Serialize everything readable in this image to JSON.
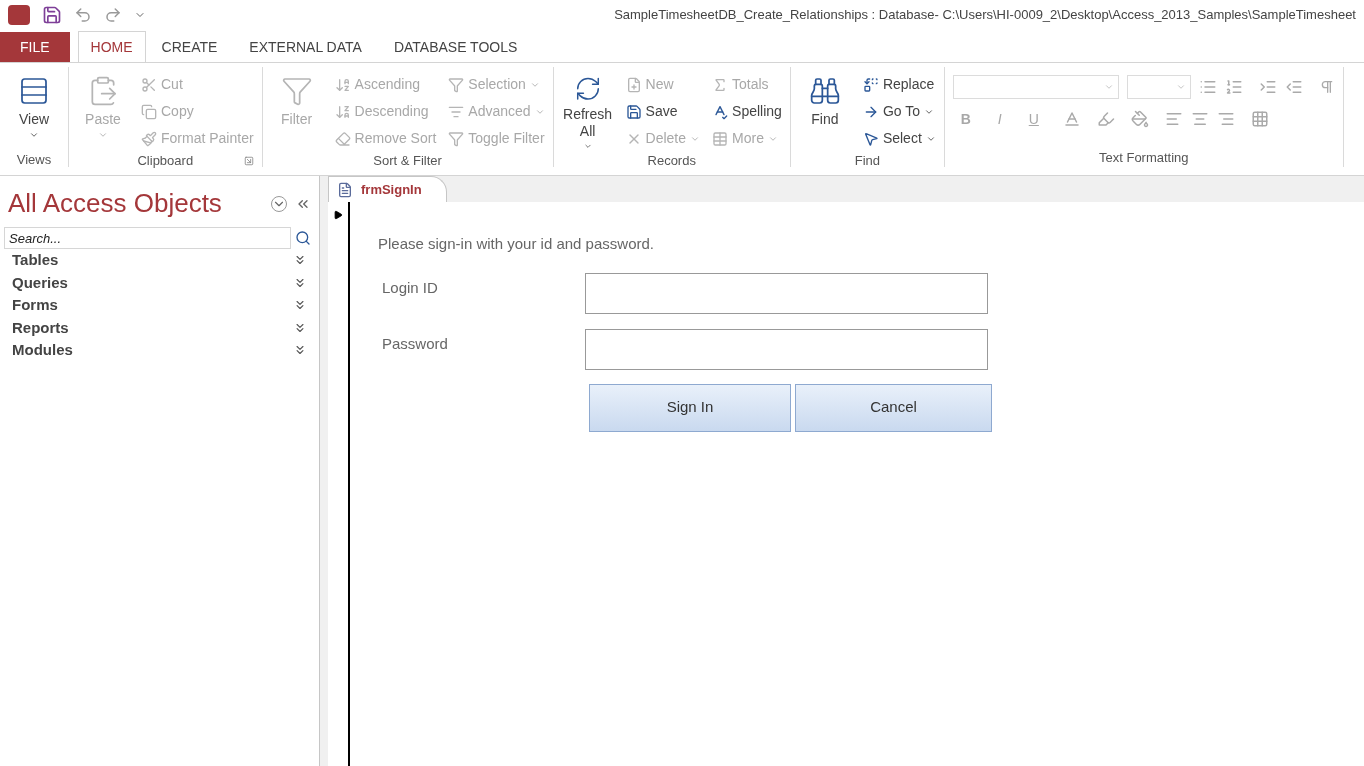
{
  "window": {
    "title": "SampleTimesheetDB_Create_Relationships : Database- C:\\Users\\HI-0009_2\\Desktop\\Access_2013_Samples\\SampleTimesheet"
  },
  "ribbon_tabs": [
    {
      "label": "FILE",
      "kind": "file",
      "selected": false
    },
    {
      "label": "HOME",
      "kind": "tab",
      "selected": true
    },
    {
      "label": "CREATE",
      "kind": "tab",
      "selected": false
    },
    {
      "label": "EXTERNAL DATA",
      "kind": "tab",
      "selected": false
    },
    {
      "label": "DATABASE TOOLS",
      "kind": "tab",
      "selected": false
    }
  ],
  "ribbon_groups": [
    {
      "label": "Views",
      "launcher": false,
      "items": [
        {
          "label": "View",
          "kind": "large",
          "disabled": false,
          "dropdown": true
        }
      ]
    },
    {
      "label": "Clipboard",
      "launcher": true,
      "items": [
        {
          "label": "Paste",
          "kind": "large",
          "disabled": true,
          "dropdown": true
        },
        {
          "label": "Cut",
          "kind": "small",
          "disabled": true,
          "dropdown": false
        },
        {
          "label": "Copy",
          "kind": "small",
          "disabled": true,
          "dropdown": false
        },
        {
          "label": "Format Painter",
          "kind": "small",
          "disabled": true,
          "dropdown": false
        }
      ]
    },
    {
      "label": "Sort & Filter",
      "launcher": false,
      "items": [
        {
          "label": "Filter",
          "kind": "large",
          "disabled": true,
          "dropdown": false
        },
        {
          "label": "Ascending",
          "kind": "small",
          "disabled": true,
          "dropdown": false
        },
        {
          "label": "Descending",
          "kind": "small",
          "disabled": true,
          "dropdown": false
        },
        {
          "label": "Remove Sort",
          "kind": "small",
          "disabled": true,
          "dropdown": false
        },
        {
          "label": "Selection",
          "kind": "small",
          "disabled": true,
          "dropdown": true
        },
        {
          "label": "Advanced",
          "kind": "small",
          "disabled": true,
          "dropdown": true
        },
        {
          "label": "Toggle Filter",
          "kind": "small",
          "disabled": true,
          "dropdown": false
        }
      ]
    },
    {
      "label": "Records",
      "launcher": false,
      "items": [
        {
          "label": "Refresh All",
          "kind": "large",
          "disabled": false,
          "dropdown": true
        },
        {
          "label": "New",
          "kind": "small",
          "disabled": true,
          "dropdown": false
        },
        {
          "label": "Save",
          "kind": "small",
          "disabled": false,
          "dropdown": false
        },
        {
          "label": "Delete",
          "kind": "small",
          "disabled": true,
          "dropdown": true
        },
        {
          "label": "Totals",
          "kind": "small",
          "disabled": true,
          "dropdown": false
        },
        {
          "label": "Spelling",
          "kind": "small",
          "disabled": false,
          "dropdown": false
        },
        {
          "label": "More",
          "kind": "small",
          "disabled": true,
          "dropdown": true
        }
      ]
    },
    {
      "label": "Find",
      "launcher": false,
      "items": [
        {
          "label": "Find",
          "kind": "large",
          "disabled": false,
          "dropdown": false
        },
        {
          "label": "Replace",
          "kind": "small",
          "disabled": false,
          "dropdown": false
        },
        {
          "label": "Go To",
          "kind": "small",
          "disabled": false,
          "dropdown": true
        },
        {
          "label": "Select",
          "kind": "small",
          "disabled": false,
          "dropdown": true
        }
      ]
    },
    {
      "label": "Text Formatting",
      "launcher": false,
      "items": [
        {
          "label": "B",
          "kind": "format",
          "disabled": true
        },
        {
          "label": "I",
          "kind": "format",
          "disabled": true
        },
        {
          "label": "U",
          "kind": "format",
          "disabled": true
        }
      ]
    }
  ],
  "nav_pane": {
    "title": "All Access Objects",
    "search": {
      "placeholder": "Search..."
    },
    "categories": [
      {
        "label": "Tables"
      },
      {
        "label": "Queries"
      },
      {
        "label": "Forms"
      },
      {
        "label": "Reports"
      },
      {
        "label": "Modules"
      }
    ]
  },
  "document_tabs": [
    {
      "label": "frmSignIn",
      "selected": true
    }
  ],
  "form": {
    "instruction": "Please sign-in with your id and password.",
    "fields": [
      {
        "label": "Login ID"
      },
      {
        "label": "Password"
      }
    ],
    "buttons": [
      {
        "label": "Sign In"
      },
      {
        "label": "Cancel"
      }
    ]
  }
}
